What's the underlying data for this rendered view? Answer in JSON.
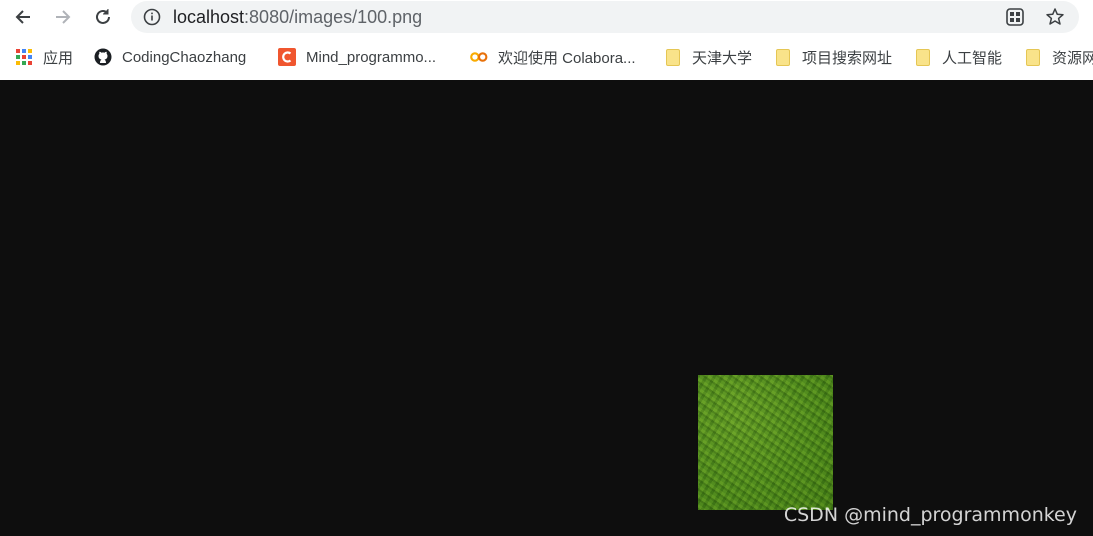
{
  "address_bar": {
    "host": "localhost",
    "path": ":8080/images/100.png"
  },
  "bookmarks": [
    {
      "label": "应用",
      "icon": "apps-grid-icon"
    },
    {
      "label": "CodingChaozhang",
      "icon": "github-icon"
    },
    {
      "label": "Mind_programmo...",
      "icon": "csdn-logo-icon"
    },
    {
      "label": "欢迎使用 Colabora...",
      "icon": "colab-icon"
    },
    {
      "label": "天津大学",
      "icon": "folder-icon"
    },
    {
      "label": "项目搜索网址",
      "icon": "folder-icon"
    },
    {
      "label": "人工智能",
      "icon": "folder-icon"
    },
    {
      "label": "资源网",
      "icon": "folder-icon"
    }
  ],
  "page": {
    "background": "#0e0e0e",
    "image_color": "#4e8d1d"
  },
  "watermark": "CSDN @mind_programmonkey"
}
